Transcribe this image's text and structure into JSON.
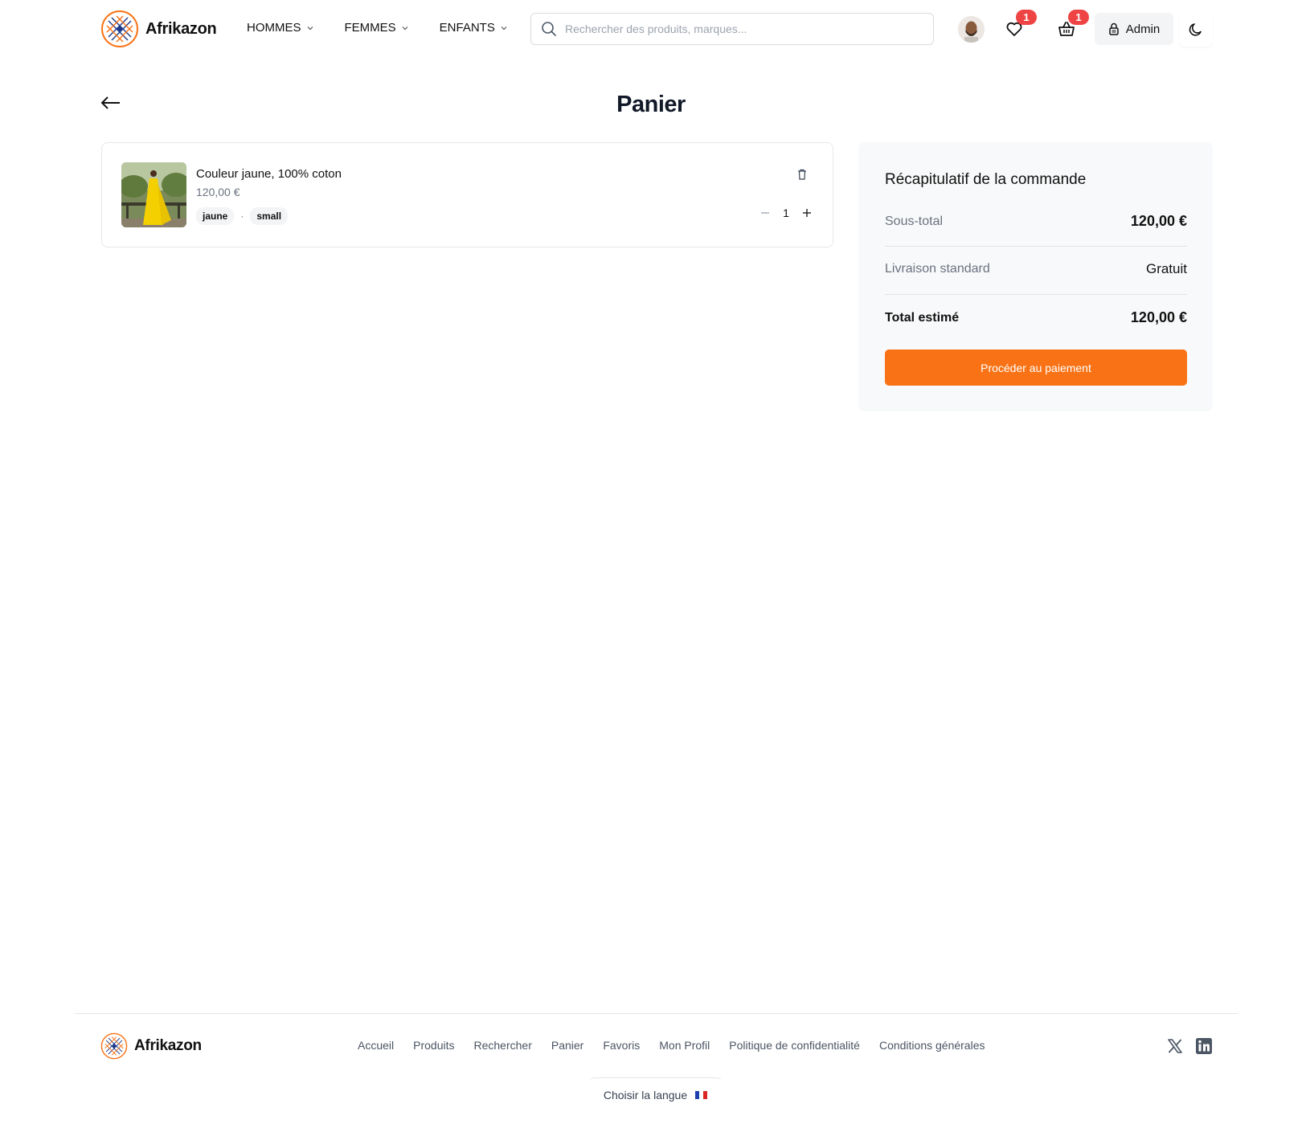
{
  "brand": {
    "name": "Afrikazon"
  },
  "nav": [
    {
      "label": "HOMMES"
    },
    {
      "label": "FEMMES"
    },
    {
      "label": "ENFANTS"
    }
  ],
  "search": {
    "placeholder": "Rechercher des produits, marques...",
    "value": ""
  },
  "header": {
    "wishlist_count": "1",
    "cart_count": "1",
    "admin_label": "Admin"
  },
  "page": {
    "title": "Panier"
  },
  "cart": {
    "items": [
      {
        "name": "Couleur jaune, 100% coton",
        "price": "120,00 €",
        "color": "jaune",
        "separator": "·",
        "size": "small",
        "quantity": "1"
      }
    ]
  },
  "summary": {
    "title": "Récapitulatif de la commande",
    "subtotal_label": "Sous-total",
    "subtotal_value": "120,00 €",
    "shipping_label": "Livraison standard",
    "shipping_value": "Gratuit",
    "total_label": "Total estimé",
    "total_value": "120,00 €",
    "checkout_label": "Procéder au paiement"
  },
  "footer": {
    "links": [
      "Accueil",
      "Produits",
      "Rechercher",
      "Panier",
      "Favoris",
      "Mon Profil",
      "Politique de confidentialité",
      "Conditions générales"
    ],
    "language_label": "Choisir la langue"
  },
  "icons": {
    "logo": "afrikazon-logo",
    "search": "search-icon",
    "wishlist": "heart-icon",
    "cart": "basket-icon",
    "admin": "lock-icon",
    "theme": "moon-icon",
    "back": "arrow-left-icon",
    "delete": "trash-icon",
    "x": "x-social-icon",
    "linkedin": "linkedin-icon",
    "flag": "france-flag-icon"
  },
  "colors": {
    "accent": "#f97316",
    "badge": "#ef4444",
    "summary_bg": "#f8f9fa"
  }
}
